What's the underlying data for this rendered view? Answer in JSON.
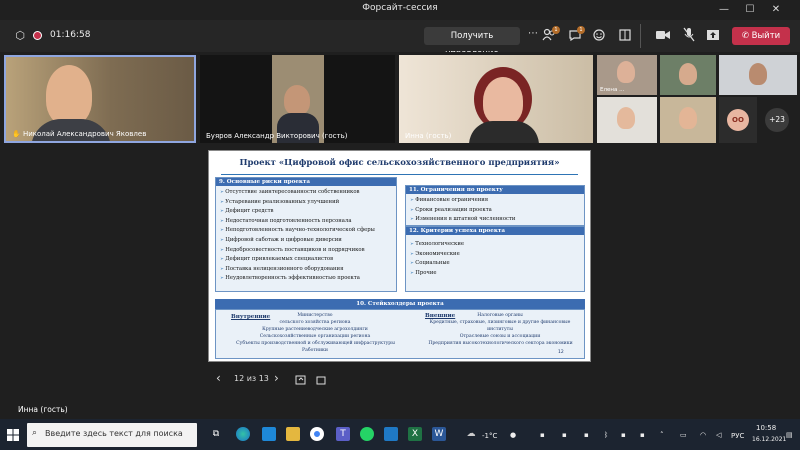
{
  "window": {
    "title": "Форсайт-сессия",
    "minimize": "—",
    "maximize": "☐",
    "close": "✕"
  },
  "meeting": {
    "timer": "01:16:58",
    "control_label": "Получить управление",
    "leave_label": "Выйти",
    "participants_badge": "1",
    "chat_badge": "1"
  },
  "participants": [
    {
      "name": "Николай Александрович Яковлев",
      "hand_icon": "✋"
    },
    {
      "name": "Буяров Александр Викторович (гость)"
    },
    {
      "name": "Инна (гость)"
    },
    {
      "name": "Елена ..."
    }
  ],
  "more_count": "+23",
  "oo_initials": "ОО",
  "bottom_label": "Инна (гость)",
  "slide": {
    "title": "Проект «Цифровой офис сельскохозяйственного предприятия»",
    "risks_header": "9. Основные риски проекта",
    "risks": [
      "Отсутствие заинтересованности собственников",
      "Устаревание реализованных улучшений",
      "Дефицит средств",
      "Недостаточная подготовленность персонала",
      "Неподготовленность научно-технологической сферы",
      "Цифровой саботаж и цифровые диверсии",
      "Недобросовестность поставщиков и подрядчиков",
      "Дефицит привлекаемых специалистов",
      "Поставка нелицензионного оборудования",
      "Неудовлетворенность эффективностью проекта"
    ],
    "limits_header": "11. Ограничения по проекту",
    "limits": [
      "Финансовые ограничения",
      "Сроки реализации проекта",
      "Изменения в штатной численности"
    ],
    "criteria_header": "12. Критерии успеха проекта",
    "criteria": [
      "Технологические",
      "Экономические",
      "Социальные",
      "Прочие"
    ],
    "stake_header": "10. Стейкхолдеры проекта",
    "internal_label": "Внутренние",
    "internal_items": [
      "Министерство",
      "сельского хозяйства региона",
      "Крупные растениеводческие агрохолдинги",
      "Сельскохозяйственные организации региона",
      "Субъекты производственной и обслуживающей инфраструктуры",
      "Работники"
    ],
    "external_label": "Внешние",
    "external_items": [
      "Налоговые органы",
      "Кредитные, страховые, лизинговые и другие финансовые",
      "институты",
      "Отраслевые союзы и ассоциации",
      "Предприятия высокотехнологического сектора экономики"
    ],
    "page_number": "12"
  },
  "slide_nav": {
    "counter": "12 из 13",
    "prev": "‹",
    "next": "›"
  },
  "taskbar": {
    "search_placeholder": "Введите здесь текст для поиска",
    "weather": "-1°C",
    "language": "РУС",
    "time": "10:58",
    "date": "16.12.2021"
  },
  "colors": {
    "leave": "#c4314b",
    "slide_header": "#3c6cb1",
    "slide_bg": "#eaf1f8"
  }
}
